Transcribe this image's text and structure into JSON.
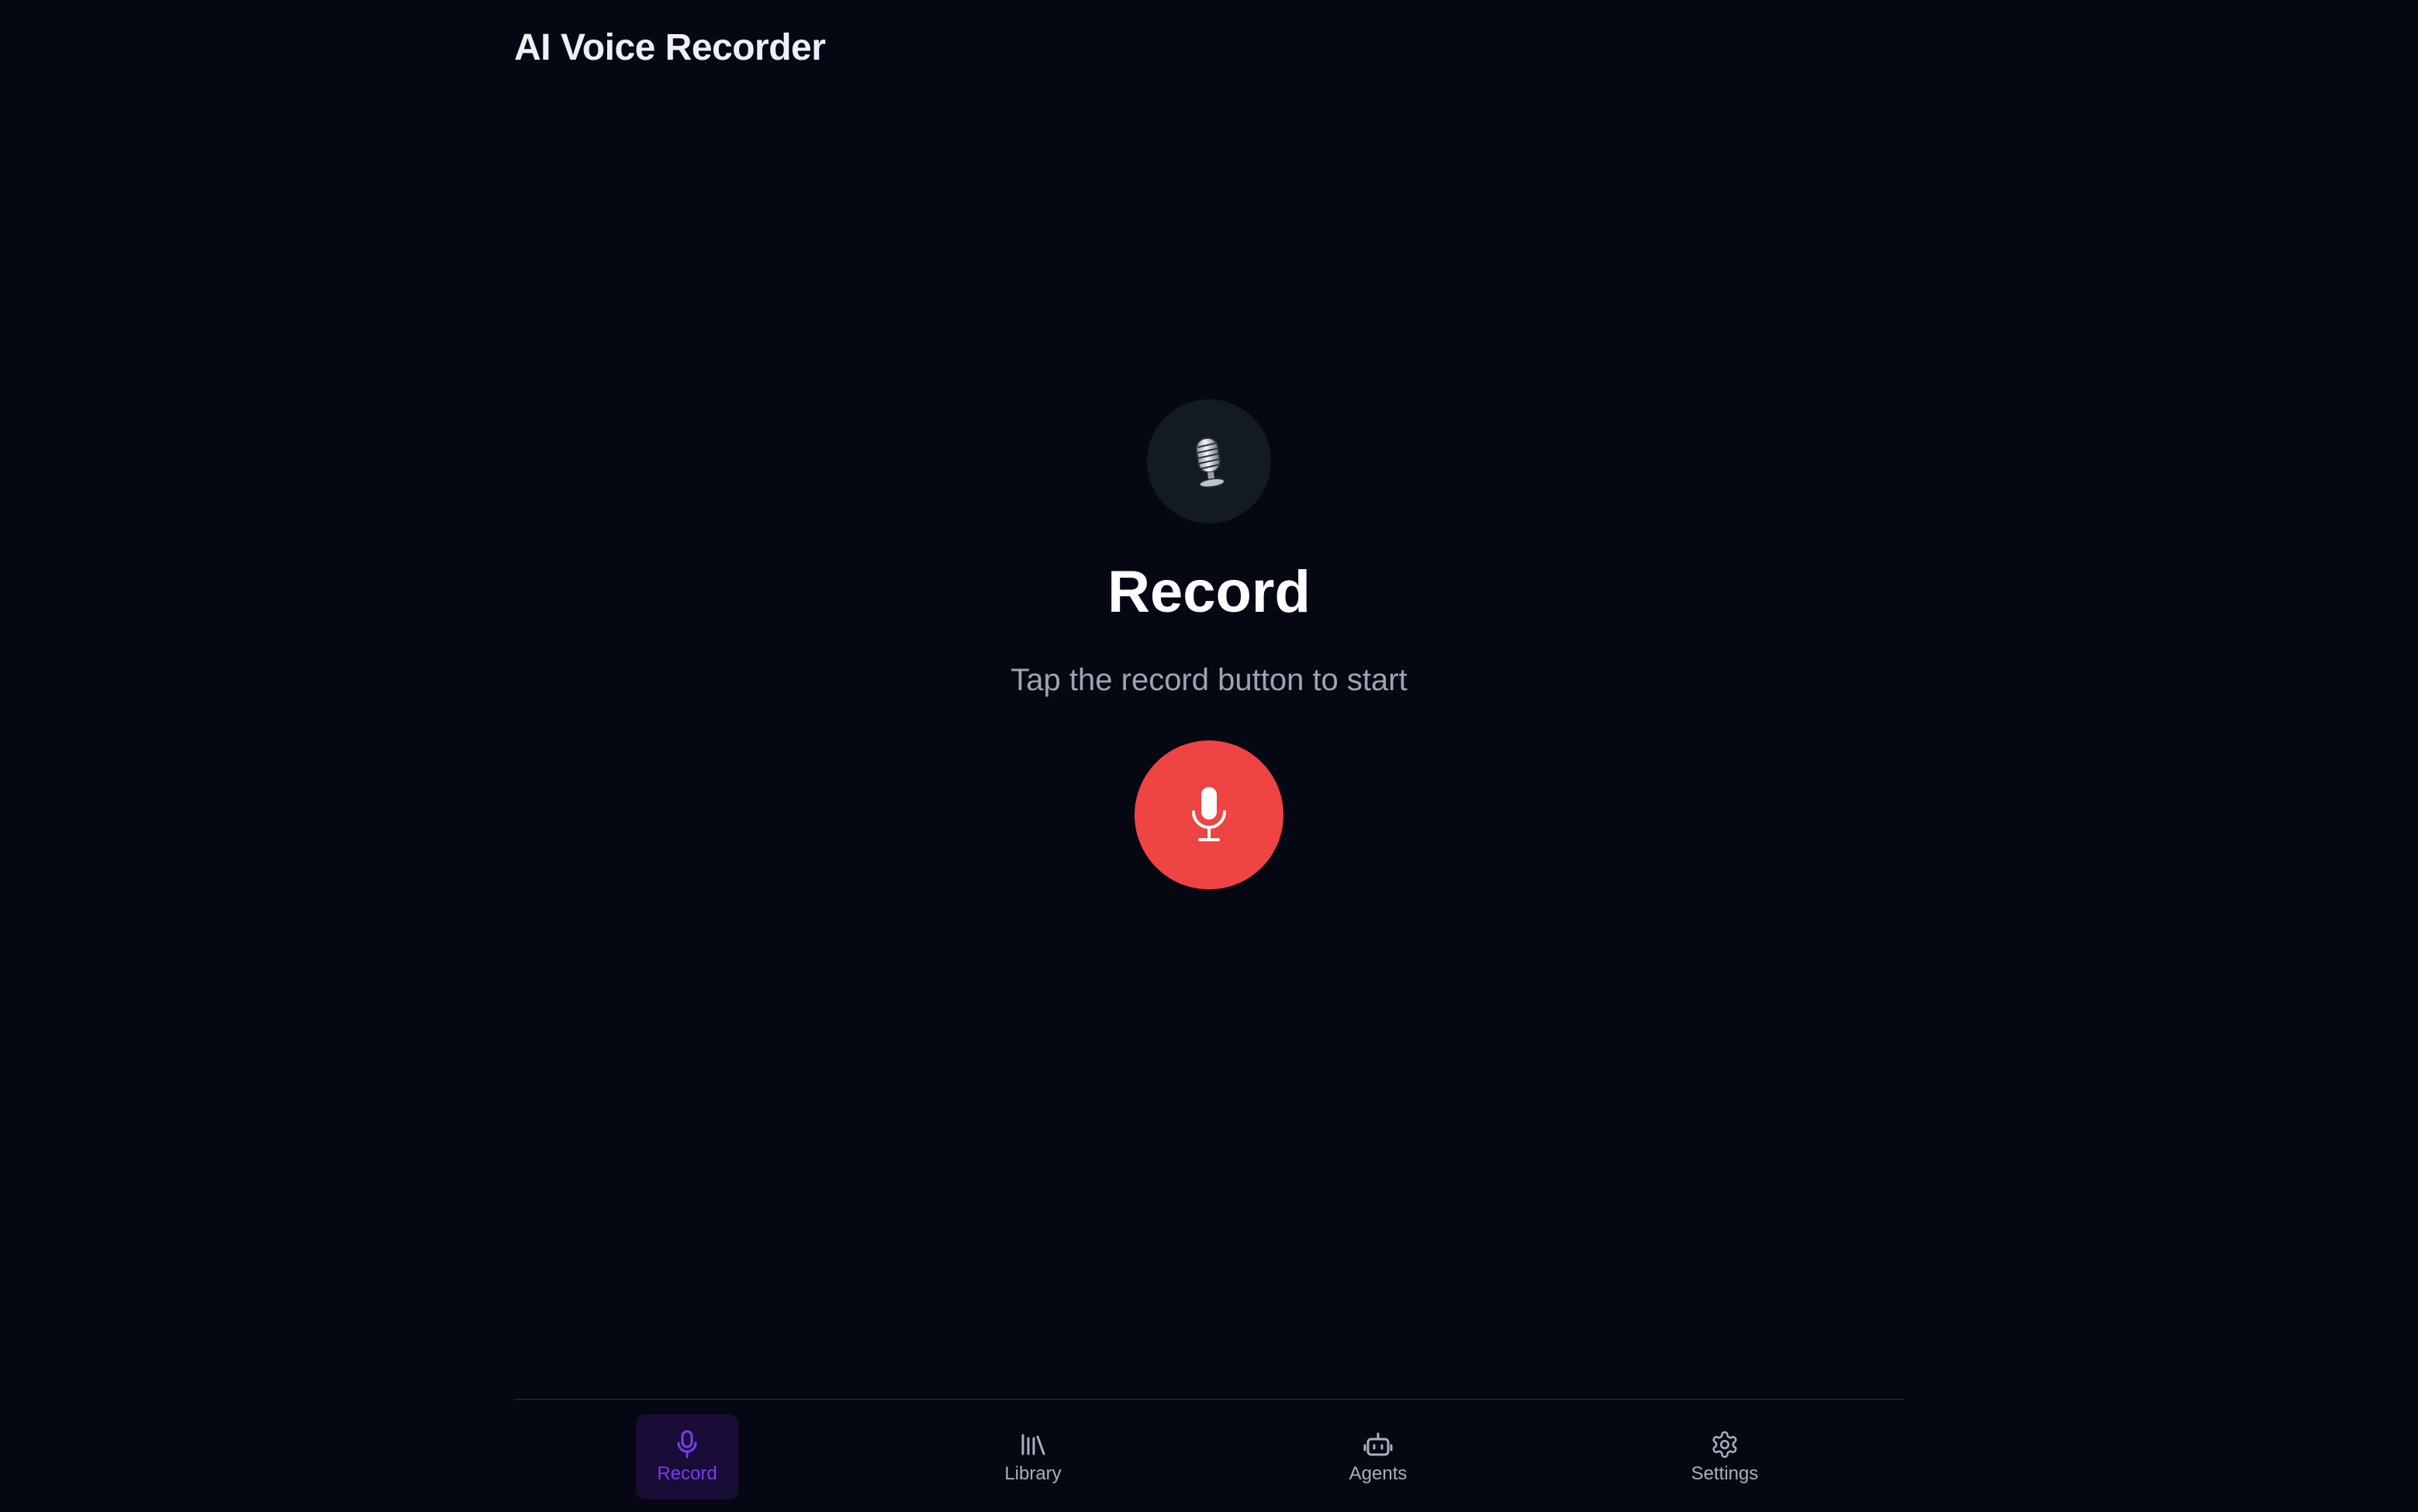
{
  "header": {
    "title": "AI Voice Recorder"
  },
  "main": {
    "heading": "Record",
    "hint": "Tap the record button to start",
    "badge_icon": "microphone-badge-icon",
    "record_button_icon": "microphone-icon"
  },
  "nav": {
    "items": [
      {
        "label": "Record",
        "icon": "microphone-icon",
        "active": true
      },
      {
        "label": "Library",
        "icon": "library-icon",
        "active": false
      },
      {
        "label": "Agents",
        "icon": "bot-icon",
        "active": false
      },
      {
        "label": "Settings",
        "icon": "gear-icon",
        "active": false
      }
    ]
  },
  "colors": {
    "background": "#050812",
    "record_button": "#ef4444",
    "accent": "#7c3aed",
    "active_tab_bg": "#180d36",
    "muted_text": "#9ea4b2"
  }
}
